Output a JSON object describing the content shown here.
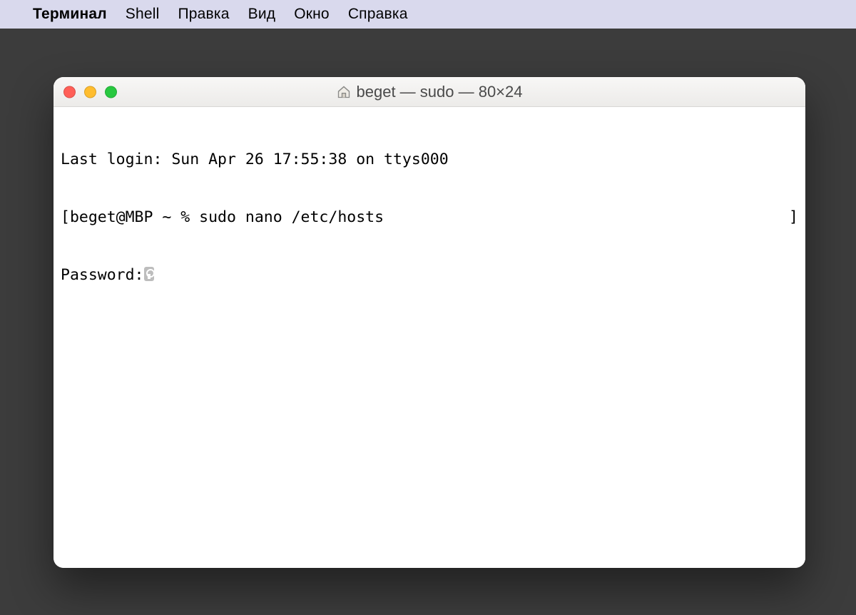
{
  "menubar": {
    "app_name": "Терминал",
    "items": [
      "Shell",
      "Правка",
      "Вид",
      "Окно",
      "Справка"
    ]
  },
  "window": {
    "title": "beget — sudo — 80×24"
  },
  "terminal": {
    "last_login": "Last login: Sun Apr 26 17:55:38 on ttys000",
    "prompt_left": "[beget@MBP ~ % sudo nano /etc/hosts",
    "prompt_right": "]",
    "password_label": "Password:"
  }
}
